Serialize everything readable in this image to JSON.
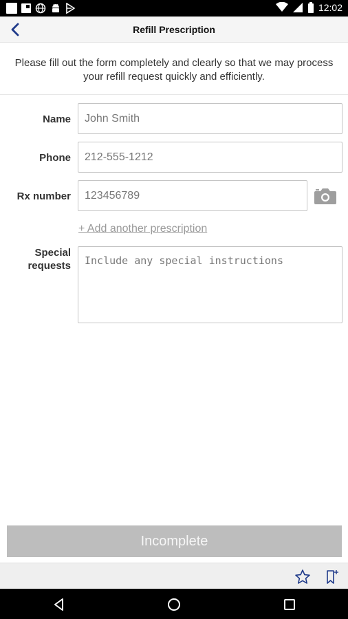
{
  "status_bar": {
    "time": "12:02",
    "icons": [
      "notification-square-icon",
      "notification-square-icon",
      "globe-icon",
      "android-icon",
      "play-store-icon",
      "wifi-icon",
      "signal-icon",
      "battery-icon"
    ]
  },
  "header": {
    "title": "Refill Prescription",
    "back_icon": "chevron-left-icon"
  },
  "intro": {
    "text": "Please fill out the form completely and clearly so that we may process your refill request quickly and efficiently."
  },
  "form": {
    "name": {
      "label": "Name",
      "value": "John Smith"
    },
    "phone": {
      "label": "Phone",
      "value": "212-555-1212"
    },
    "rx_number": {
      "label": "Rx number",
      "value": "123456789"
    },
    "add_prescription_link": "+ Add another prescription",
    "special_requests": {
      "label_line1": "Special",
      "label_line2": "requests",
      "placeholder": "Include any special instructions"
    }
  },
  "submit": {
    "label": "Incomplete"
  },
  "toolbar": {
    "icons": [
      "star-icon",
      "bookmark-add-icon"
    ]
  },
  "nav": {
    "icons": [
      "back-triangle-icon",
      "home-circle-icon",
      "recents-square-icon"
    ]
  },
  "colors": {
    "accent": "#1f3a8a",
    "disabled_button": "#bdbdbd"
  }
}
